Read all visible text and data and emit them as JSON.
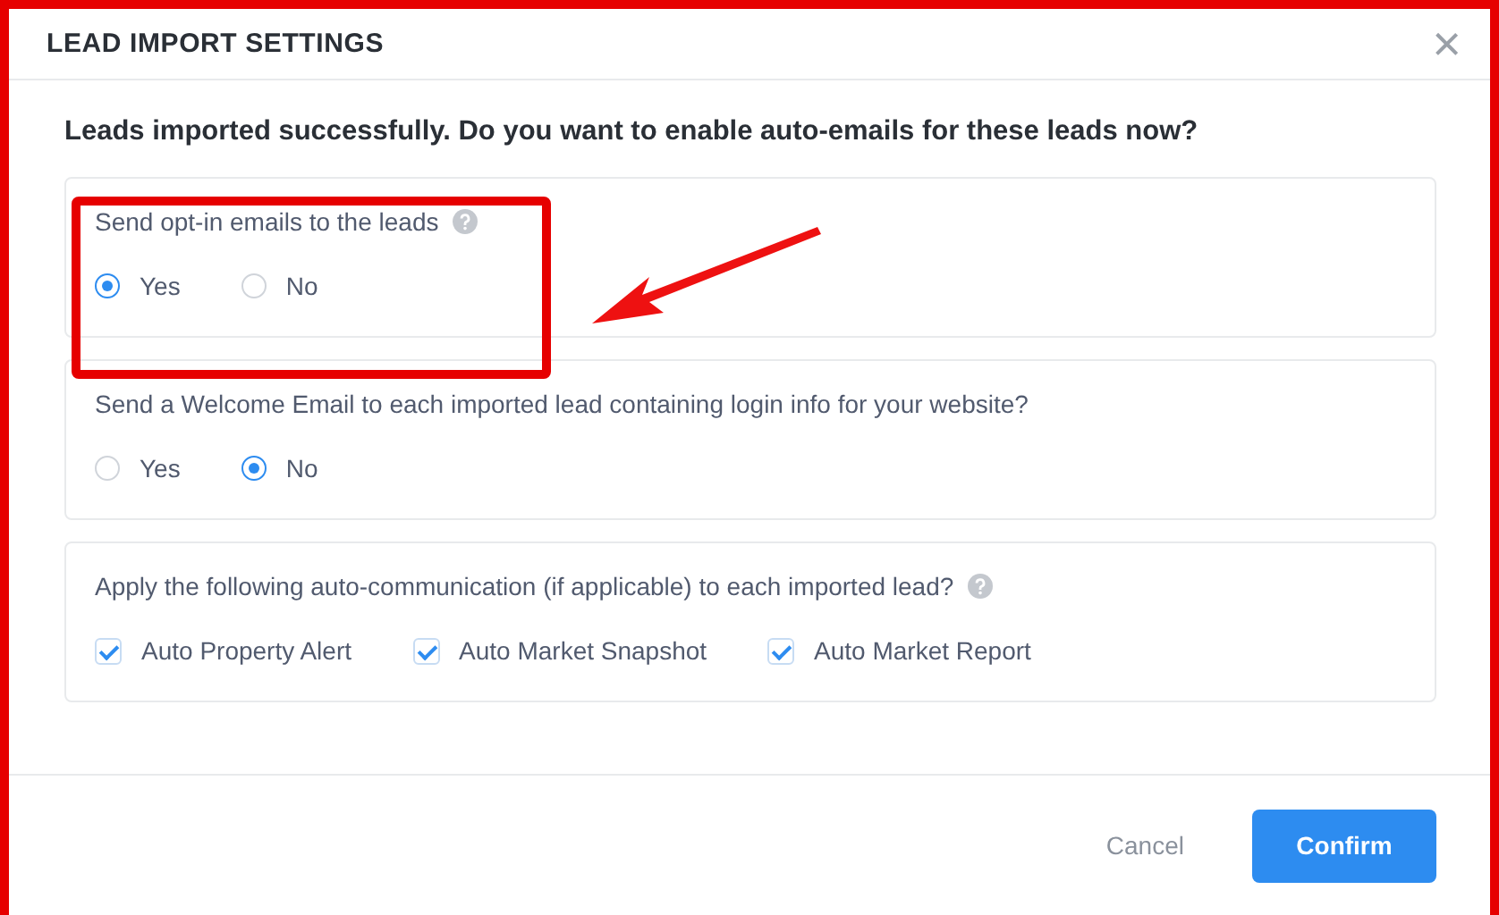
{
  "dialog": {
    "title": "LEAD IMPORT SETTINGS",
    "close": "×"
  },
  "question": "Leads imported successfully. Do you want to enable auto-emails for these leads now?",
  "sections": [
    {
      "kind": "radio",
      "label": "Send opt-in emails to the leads",
      "help": true,
      "options": [
        {
          "label": "Yes",
          "selected": true
        },
        {
          "label": "No",
          "selected": false
        }
      ]
    },
    {
      "kind": "radio",
      "label": "Send a Welcome Email to each imported lead containing login info for your website?",
      "help": false,
      "options": [
        {
          "label": "Yes",
          "selected": false
        },
        {
          "label": "No",
          "selected": true
        }
      ]
    },
    {
      "kind": "checkbox",
      "label": "Apply the following auto-communication (if applicable) to each imported lead?",
      "help": true,
      "options": [
        {
          "label": "Auto Property Alert",
          "checked": true
        },
        {
          "label": "Auto Market Snapshot",
          "checked": true
        },
        {
          "label": "Auto Market Report",
          "checked": true
        }
      ]
    }
  ],
  "buttons": {
    "cancel": "Cancel",
    "confirm": "Confirm"
  }
}
